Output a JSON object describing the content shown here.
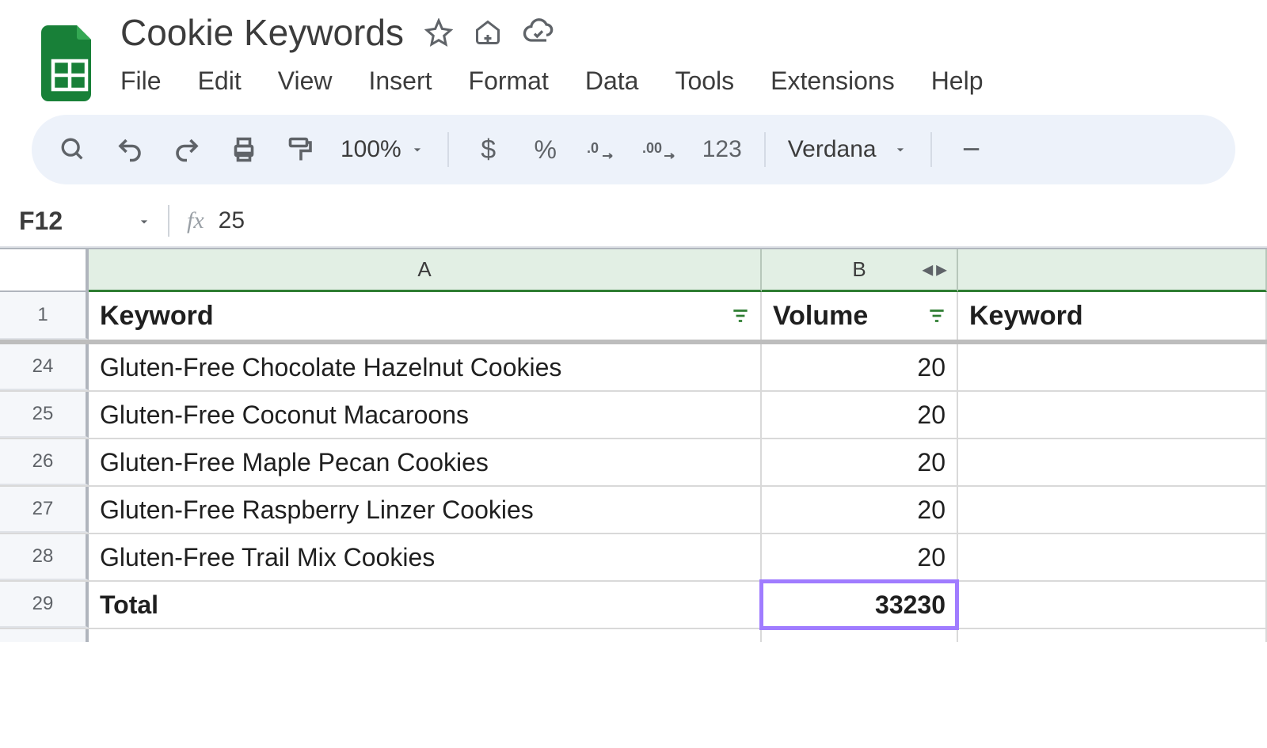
{
  "doc": {
    "title": "Cookie Keywords"
  },
  "menu": {
    "file": "File",
    "edit": "Edit",
    "view": "View",
    "insert": "Insert",
    "format": "Format",
    "data": "Data",
    "tools": "Tools",
    "extensions": "Extensions",
    "help": "Help"
  },
  "toolbar": {
    "zoom": "100%",
    "num_format": "123",
    "font": "Verdana"
  },
  "name_box": {
    "ref": "F12",
    "fx_label": "fx",
    "fx_value": "25"
  },
  "columns": {
    "A": "A",
    "B": "B"
  },
  "header_row_num": "1",
  "headers": {
    "A": "Keyword",
    "B": "Volume",
    "C": "Keyword"
  },
  "rows": [
    {
      "n": "24",
      "keyword": "Gluten-Free Chocolate Hazelnut Cookies",
      "volume": "20"
    },
    {
      "n": "25",
      "keyword": "Gluten-Free Coconut Macaroons",
      "volume": "20"
    },
    {
      "n": "26",
      "keyword": "Gluten-Free Maple Pecan Cookies",
      "volume": "20"
    },
    {
      "n": "27",
      "keyword": "Gluten-Free Raspberry Linzer Cookies",
      "volume": "20"
    },
    {
      "n": "28",
      "keyword": "Gluten-Free Trail Mix Cookies",
      "volume": "20"
    }
  ],
  "total_row": {
    "n": "29",
    "label": "Total",
    "value": "33230"
  }
}
